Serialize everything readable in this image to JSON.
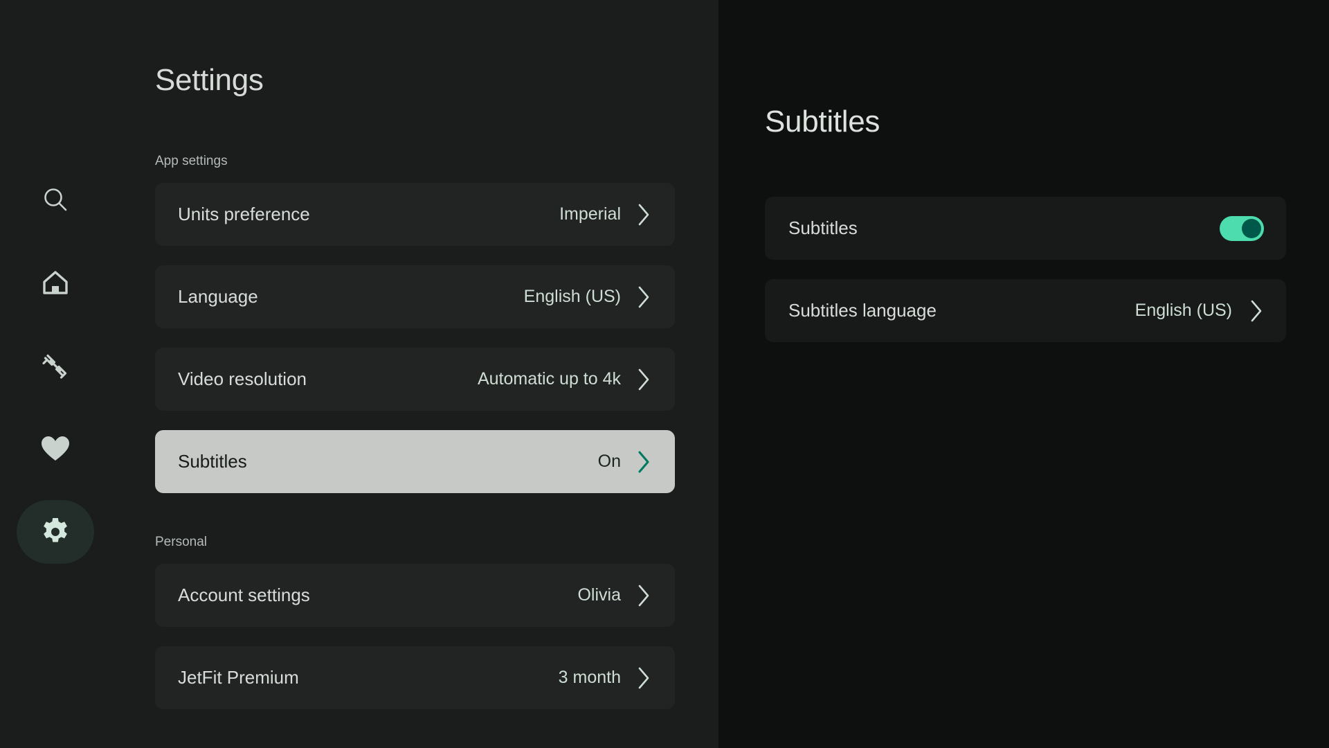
{
  "sidebar": {
    "items": [
      {
        "name": "search",
        "icon": "search-icon",
        "active": false
      },
      {
        "name": "home",
        "icon": "home-icon",
        "active": false
      },
      {
        "name": "workouts",
        "icon": "dumbbell-icon",
        "active": false
      },
      {
        "name": "favorites",
        "icon": "heart-icon",
        "active": false
      },
      {
        "name": "settings",
        "icon": "gear-icon",
        "active": true
      }
    ]
  },
  "left": {
    "title": "Settings",
    "sections": [
      {
        "label": "App settings",
        "rows": [
          {
            "label": "Units preference",
            "value": "Imperial",
            "selected": false
          },
          {
            "label": "Language",
            "value": "English (US)",
            "selected": false
          },
          {
            "label": "Video resolution",
            "value": "Automatic up to 4k",
            "selected": false
          },
          {
            "label": "Subtitles",
            "value": "On",
            "selected": true
          }
        ]
      },
      {
        "label": "Personal",
        "rows": [
          {
            "label": "Account settings",
            "value": "Olivia",
            "selected": false
          },
          {
            "label": "JetFit Premium",
            "value": "3 month",
            "selected": false
          }
        ]
      }
    ]
  },
  "right": {
    "title": "Subtitles",
    "rows": [
      {
        "label": "Subtitles",
        "control": "toggle",
        "value": "",
        "toggle_on": true
      },
      {
        "label": "Subtitles language",
        "control": "chevron",
        "value": "English (US)"
      }
    ]
  },
  "colors": {
    "left_panel_bg": "#1b1d1c",
    "right_panel_bg": "#0d100f",
    "row_bg": "#212423",
    "row_bg_right": "#171a19",
    "row_selected_bg": "#c6c9c6",
    "value_text": "#cfded4",
    "label_text": "#d8ddd9",
    "accent_green": "#4ddcad",
    "accent_green_dark": "#00584a",
    "chevron_selected": "#00795f",
    "rail_active_bg": "#232e2a",
    "icon_color": "#c9d2cd"
  }
}
